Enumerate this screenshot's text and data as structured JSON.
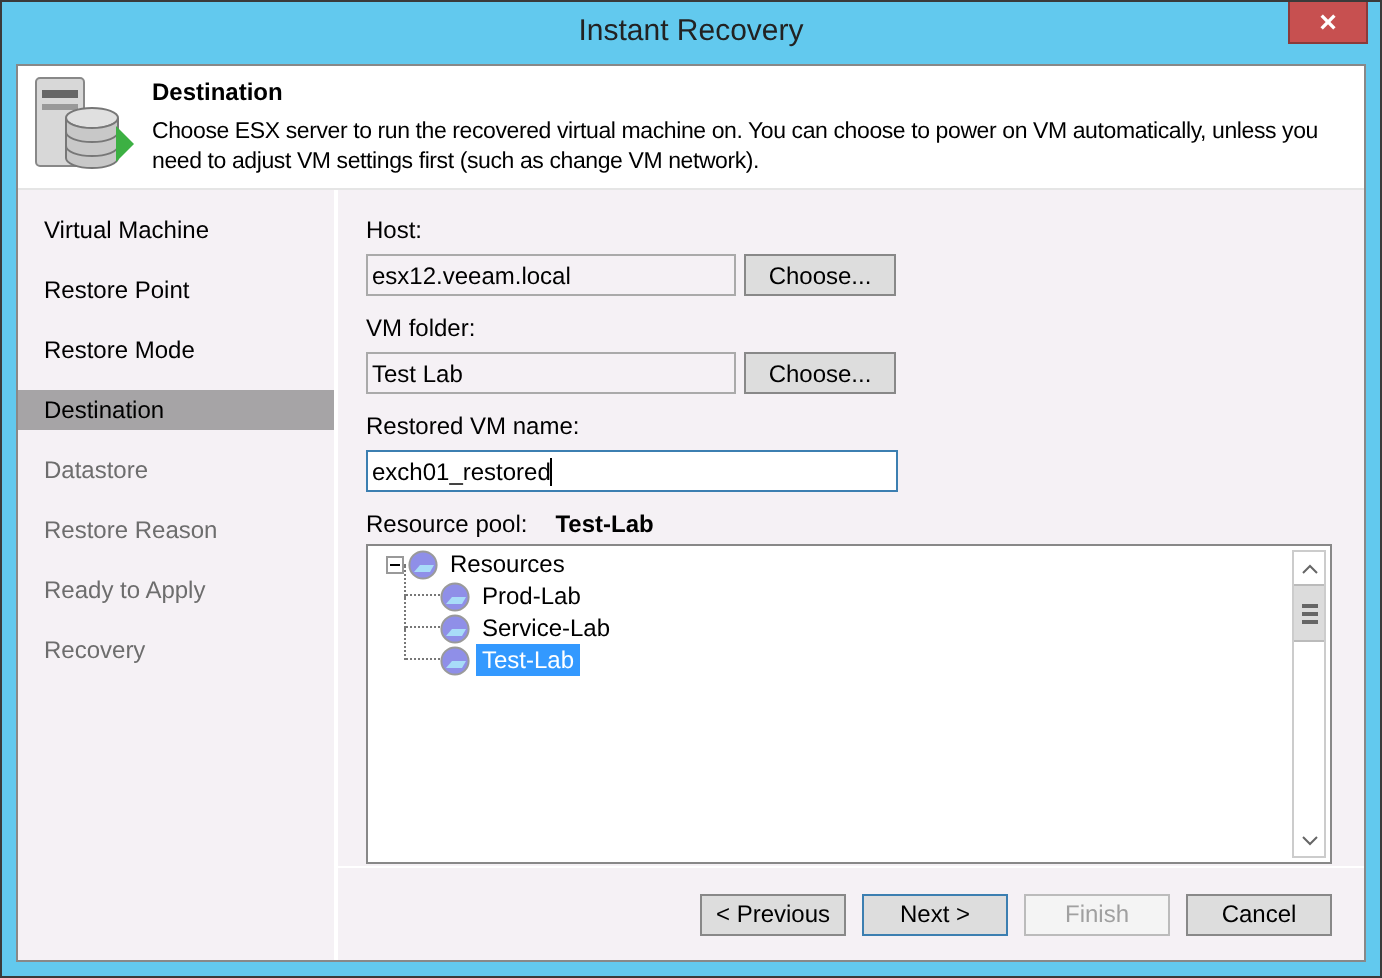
{
  "window": {
    "title": "Instant Recovery",
    "close": "×"
  },
  "header": {
    "title": "Destination",
    "description": "Choose ESX server to run the recovered virtual machine on. You can choose to power on VM automatically, unless you need to adjust VM settings first (such as change VM network)."
  },
  "steps": [
    {
      "label": "Virtual Machine",
      "selected": false,
      "disabled": false
    },
    {
      "label": "Restore Point",
      "selected": false,
      "disabled": false
    },
    {
      "label": "Restore Mode",
      "selected": false,
      "disabled": false
    },
    {
      "label": "Destination",
      "selected": true,
      "disabled": false
    },
    {
      "label": "Datastore",
      "selected": false,
      "disabled": true
    },
    {
      "label": "Restore Reason",
      "selected": false,
      "disabled": true
    },
    {
      "label": "Ready to Apply",
      "selected": false,
      "disabled": true
    },
    {
      "label": "Recovery",
      "selected": false,
      "disabled": true
    }
  ],
  "host": {
    "label": "Host:",
    "value": "esx12.veeam.local",
    "button": "Choose..."
  },
  "vm_folder": {
    "label": "VM folder:",
    "value": "Test Lab",
    "button": "Choose..."
  },
  "vm_name": {
    "label": "Restored VM name:",
    "value": "exch01_restored",
    "focused": true
  },
  "resource_pool": {
    "label": "Resource pool:",
    "value": "Test-Lab",
    "tree": [
      {
        "label": "Resources",
        "expanded": true,
        "selected": false,
        "children": [
          {
            "label": "Prod-Lab",
            "selected": false
          },
          {
            "label": "Service-Lab",
            "selected": false
          },
          {
            "label": "Test-Lab",
            "selected": true
          }
        ]
      }
    ]
  },
  "buttons": [
    {
      "label": "< Previous",
      "default": false,
      "disabled": false
    },
    {
      "label": "Next >",
      "default": true,
      "disabled": false
    },
    {
      "label": "Finish",
      "default": false,
      "disabled": true
    },
    {
      "label": "Cancel",
      "default": false,
      "disabled": false
    }
  ]
}
